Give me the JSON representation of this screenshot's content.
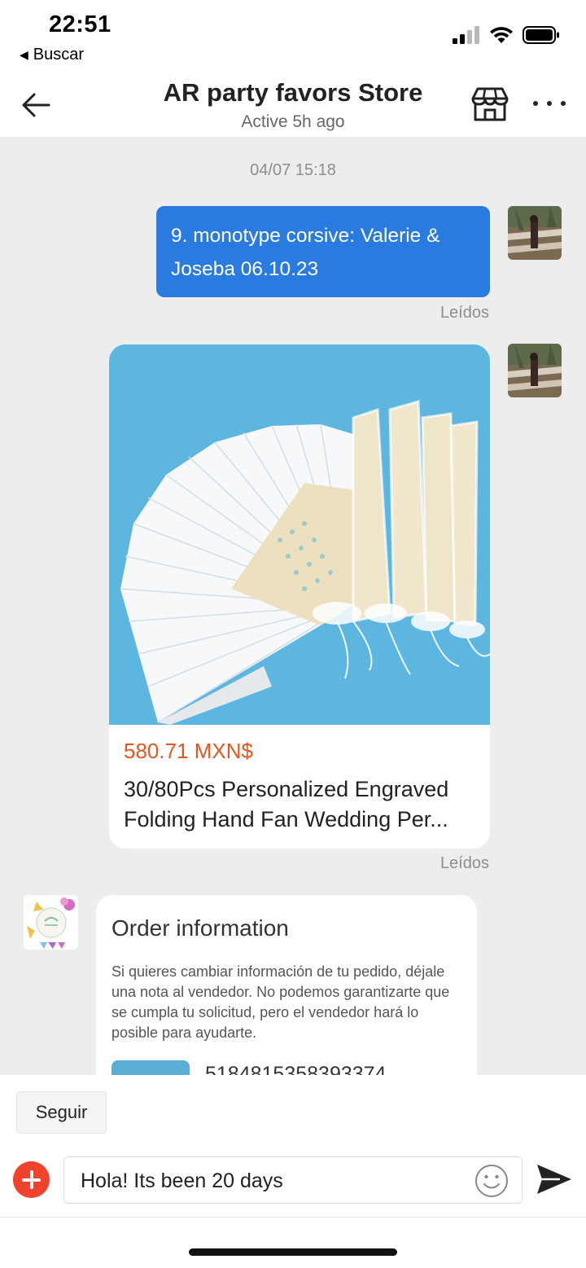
{
  "status_bar": {
    "time": "22:51",
    "back_app": "Buscar",
    "icons": [
      "cellular-signal-icon",
      "wifi-icon",
      "battery-icon"
    ]
  },
  "header": {
    "title": "AR party favors Store",
    "subtitle": "Active 5h ago",
    "icons": [
      "back-arrow-icon",
      "store-icon",
      "more-options-icon"
    ]
  },
  "chat": {
    "timestamp": "04/07 15:18",
    "messages": [
      {
        "type": "text",
        "from": "me",
        "text": "9. monotype corsive: Valerie & Joseba 06.10.23",
        "status": "Leídos"
      },
      {
        "type": "product",
        "from": "me",
        "image_icon": "folding-hand-fan-product-image",
        "price": "580.71 MXN$",
        "name": "30/80Pcs Personalized Engraved Folding Hand Fan Wedding Per...",
        "status": "Leídos"
      },
      {
        "type": "order_info",
        "from": "store",
        "title": "Order information",
        "description": "Si quieres cambiar información de tu pedido, déjale una nota al vendedor. No podemos garantizarte que se cumpla tu solicitud, pero el vendedor hará lo posible para ayudarte.",
        "order_number": "5184815358393374"
      }
    ]
  },
  "bottom_bar": {
    "follow_label": "Seguir",
    "input_value": "Hola! Its been 20 days",
    "icons": [
      "plus-icon",
      "emoji-icon",
      "send-icon"
    ]
  },
  "colors": {
    "accent_blue": "#2a7be0",
    "price_orange": "#e4571e",
    "plus_red": "#f0422d",
    "chat_background": "#ededed"
  }
}
